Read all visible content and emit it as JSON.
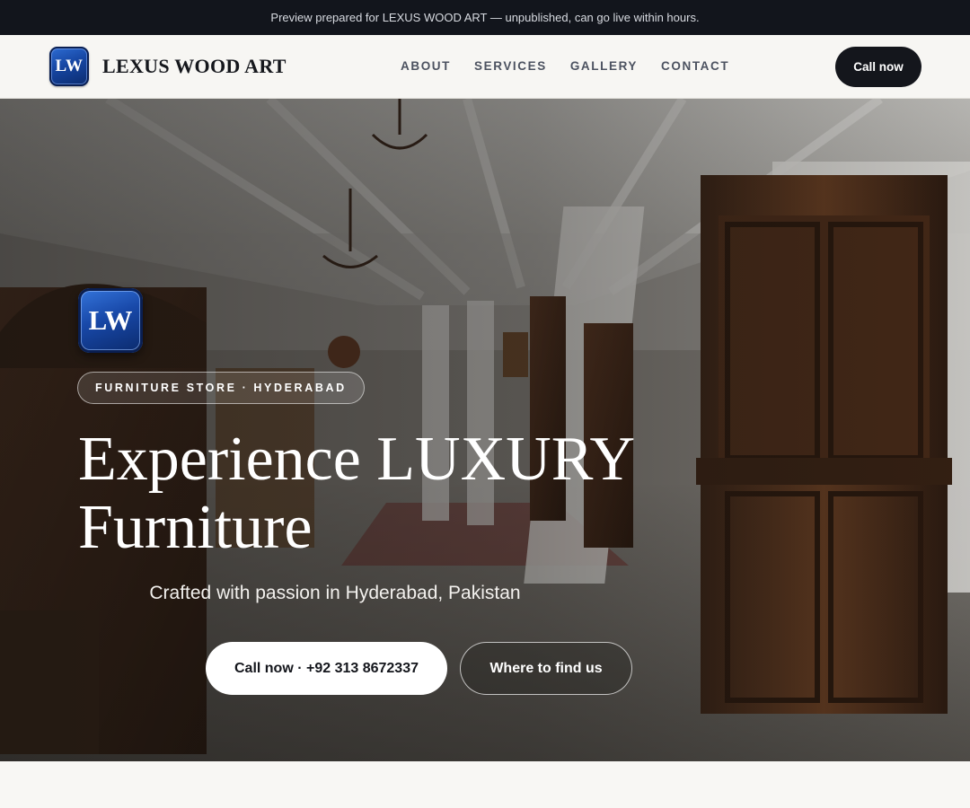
{
  "announcement": "Preview prepared for LEXUS WOOD ART — unpublished, can go live within hours.",
  "header": {
    "logo_initials": "LW",
    "brand_name": "LEXUS WOOD ART",
    "nav": [
      {
        "label": "ABOUT"
      },
      {
        "label": "SERVICES"
      },
      {
        "label": "GALLERY"
      },
      {
        "label": "CONTACT"
      }
    ],
    "call_label": "Call now"
  },
  "hero": {
    "logo_initials": "LW",
    "tag": "FURNITURE STORE · HYDERABAD",
    "title_line1": "Experience LUXURY",
    "title_line2": "Furniture",
    "subtitle": "Crafted with passion in Hyderabad, Pakistan",
    "primary_cta": "Call now · +92 313 8672337",
    "secondary_cta": "Where to find us",
    "background_image": "furniture-showroom-photo"
  },
  "colors": {
    "dark": "#12151c",
    "logo_blue": "#1646a3",
    "header_bg": "#f7f6f3",
    "page_bg": "#f8f7f4"
  }
}
